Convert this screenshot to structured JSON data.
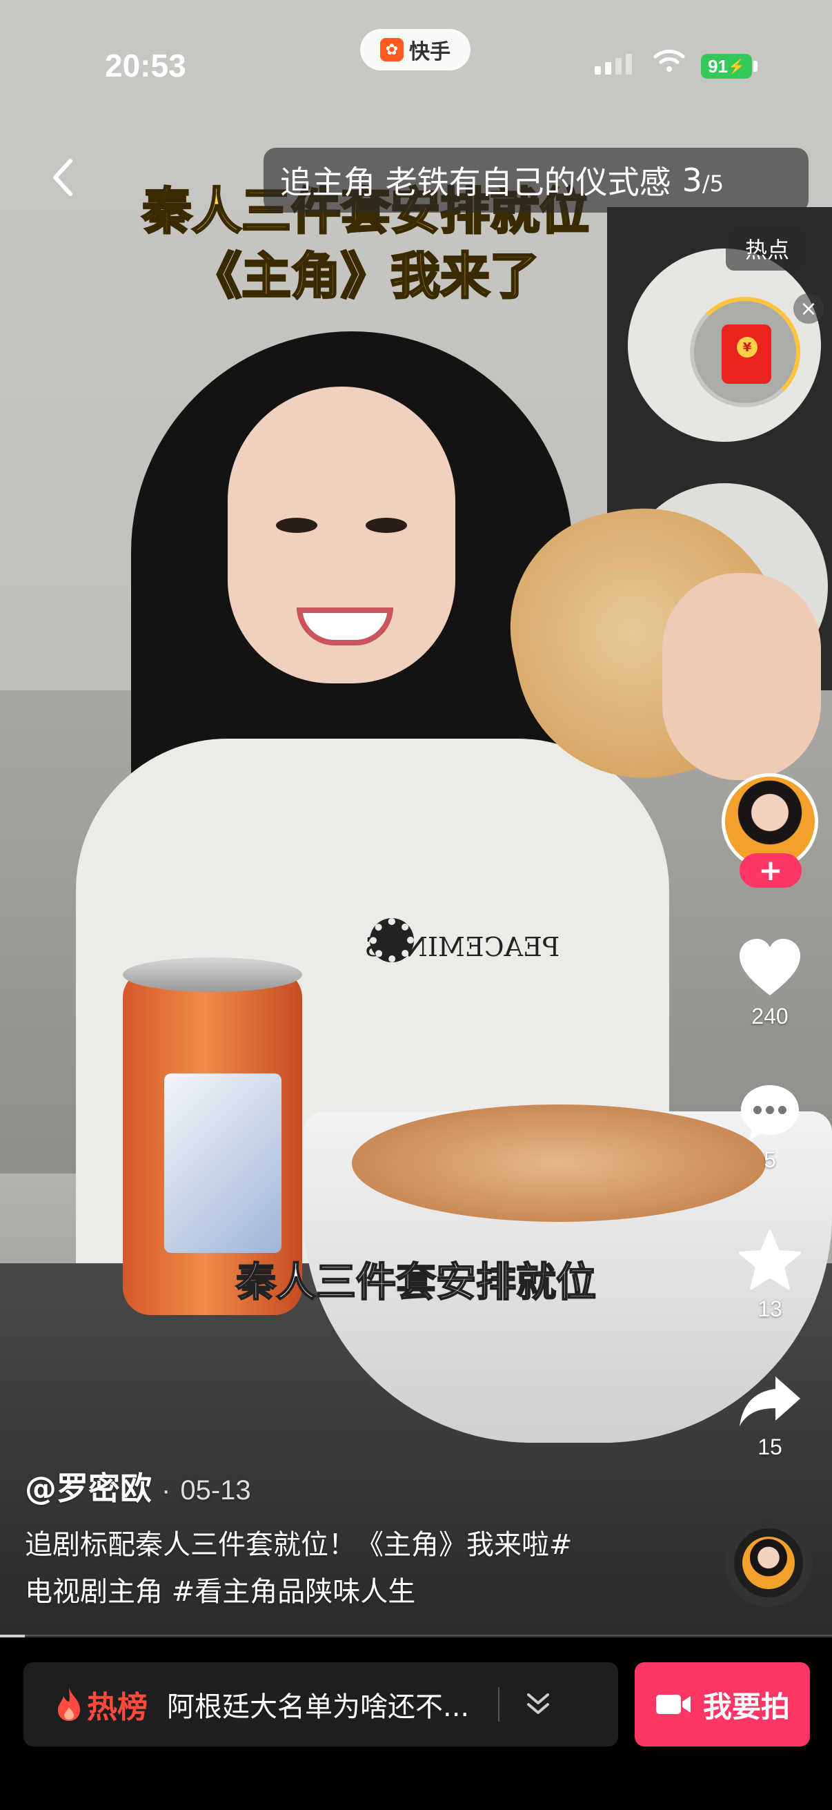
{
  "status_bar": {
    "time": "20:53",
    "app_name": "快手",
    "battery": "91"
  },
  "top": {
    "collection_title": "追主角 老铁有自己的仪式感",
    "collection_index": "3",
    "collection_total": "/5",
    "hot_tag": "热点",
    "video_caption_line1": "秦人三件套安排就位",
    "video_caption_line2": "《主角》我来了",
    "redpacket_coin": "¥"
  },
  "video": {
    "subtitle": "秦人三件套安排就位",
    "shirt_text": "PEACEMINUS",
    "progress": 0.03
  },
  "actions": {
    "follow_plus": "+",
    "likes": "240",
    "comments": "5",
    "favorites": "13",
    "shares": "15"
  },
  "post": {
    "author": "@罗密欧",
    "separator": "·",
    "date": "05-13",
    "description_line1": "追剧标配秦人三件套就位！《主角》我来啦#",
    "description_line2": "电视剧主角 #看主角品陕味人生"
  },
  "bottom_bar": {
    "hot_label": "热榜",
    "hot_text": "阿根廷大名单为啥还不...",
    "shoot_label": "我要拍"
  },
  "colors": {
    "accent": "#fe3666",
    "hot": "#ff4a3d",
    "caption_yellow": "#ffd54a"
  }
}
